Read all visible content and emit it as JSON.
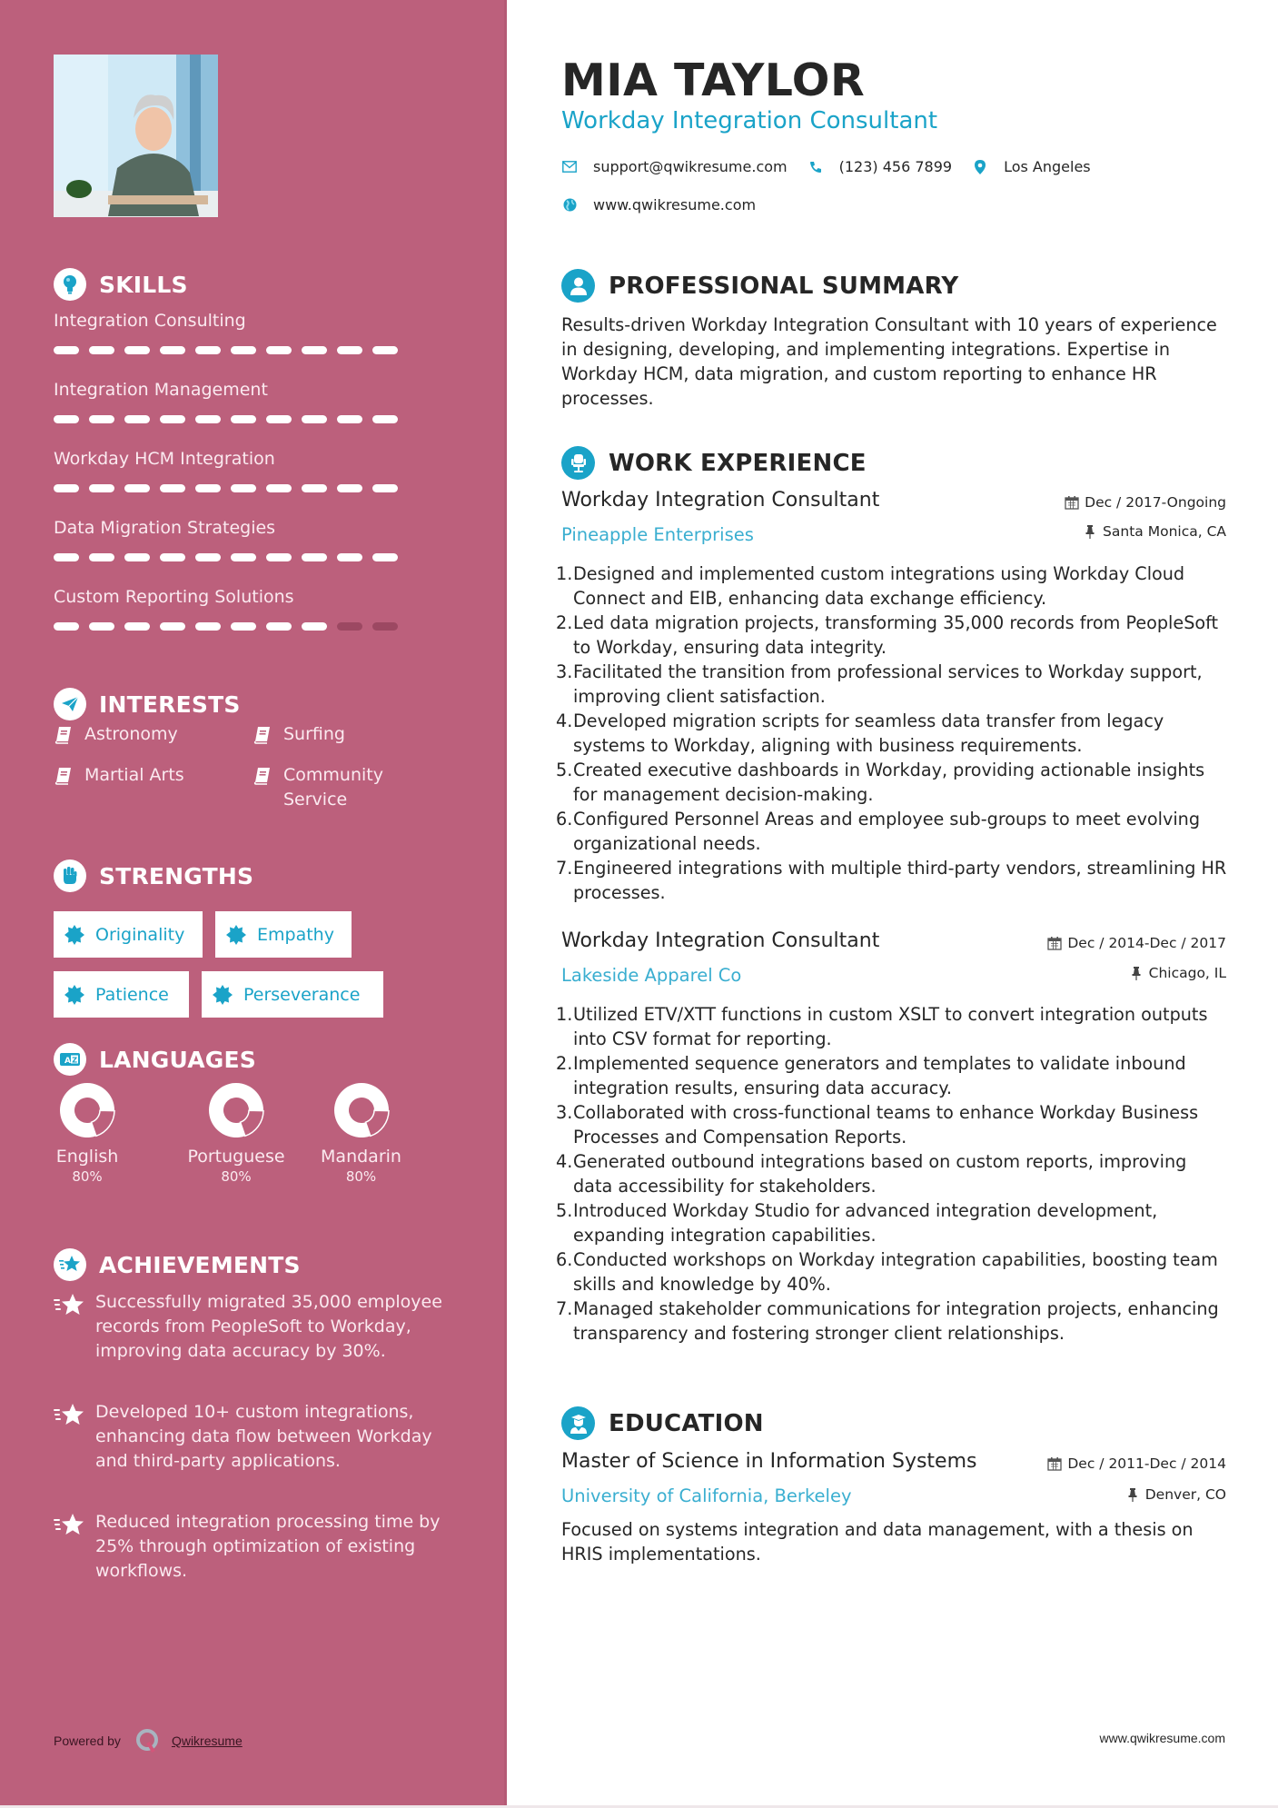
{
  "colors": {
    "sidebar_bg": "#bc607c",
    "accent": "#1aa3c8",
    "text_dark": "#262626",
    "sidebar_text": "#fbeaf0",
    "skill_off": "#9c4862"
  },
  "profile": {
    "photo_alt": "Profile photo",
    "name": "MIA TAYLOR",
    "title": "Workday Integration Consultant"
  },
  "contact": {
    "email": "support@qwikresume.com",
    "phone": "(123) 456 7899",
    "location": "Los Angeles",
    "website": "www.qwikresume.com",
    "icons": [
      "envelope-icon",
      "phone-icon",
      "map-pin-icon",
      "globe-icon"
    ]
  },
  "sidebar": {
    "skills": {
      "title": "SKILLS",
      "icon": "lightbulb-icon",
      "scale_max": 10,
      "items": [
        {
          "name": "Integration Consulting",
          "level": 10
        },
        {
          "name": "Integration Management",
          "level": 10
        },
        {
          "name": "Workday HCM Integration",
          "level": 10
        },
        {
          "name": "Data Migration Strategies",
          "level": 10
        },
        {
          "name": "Custom Reporting Solutions",
          "level": 8
        }
      ]
    },
    "interests": {
      "title": "INTERESTS",
      "icon": "paper-plane-icon",
      "items": [
        "Astronomy",
        "Surfing",
        "Martial Arts",
        "Community Service"
      ]
    },
    "strengths": {
      "title": "STRENGTHS",
      "icon": "fist-icon",
      "items": [
        "Originality",
        "Empathy",
        "Patience",
        "Perseverance"
      ]
    },
    "languages": {
      "title": "LANGUAGES",
      "icon": "translate-icon",
      "items": [
        {
          "name": "English",
          "percent": 80,
          "label": "80%"
        },
        {
          "name": "Portuguese",
          "percent": 80,
          "label": "80%"
        },
        {
          "name": "Mandarin",
          "percent": 80,
          "label": "80%"
        }
      ]
    },
    "achievements": {
      "title": "ACHIEVEMENTS",
      "icon": "star-badge-icon",
      "items": [
        "Successfully migrated 35,000 employee records from PeopleSoft to Workday, improving data accuracy by 30%.",
        "Developed 10+ custom integrations, enhancing data flow between Workday and third-party applications.",
        "Reduced integration processing time by 25% through optimization of existing workflows."
      ]
    },
    "footer": {
      "powered_by": "Powered by",
      "brand": "Qwikresume"
    }
  },
  "summary": {
    "title": "PROFESSIONAL SUMMARY",
    "text": "Results-driven Workday Integration Consultant with 10 years of experience in designing, developing, and implementing integrations. Expertise in Workday HCM, data migration, and custom reporting to enhance HR processes."
  },
  "experience": {
    "title": "WORK EXPERIENCE",
    "jobs": [
      {
        "role": "Workday Integration Consultant",
        "company": "Pineapple Enterprises",
        "dates": "Dec / 2017-Ongoing",
        "location": "Santa Monica, CA",
        "bullets": [
          "Designed and implemented custom integrations using Workday Cloud Connect and EIB, enhancing data exchange efficiency.",
          "Led data migration projects, transforming 35,000 records from PeopleSoft to Workday, ensuring data integrity.",
          "Facilitated the transition from professional services to Workday support, improving client satisfaction.",
          "Developed migration scripts for seamless data transfer from legacy systems to Workday, aligning with business requirements.",
          "Created executive dashboards in Workday, providing actionable insights for management decision-making.",
          "Configured Personnel Areas and employee sub-groups to meet evolving organizational needs.",
          "Engineered integrations with multiple third-party vendors, streamlining HR processes."
        ]
      },
      {
        "role": "Workday Integration Consultant",
        "company": "Lakeside Apparel Co",
        "dates": "Dec / 2014-Dec / 2017",
        "location": "Chicago, IL",
        "bullets": [
          "Utilized ETV/XTT functions in custom XSLT to convert integration outputs into CSV format for reporting.",
          "Implemented sequence generators and templates to validate inbound integration results, ensuring data accuracy.",
          "Collaborated with cross-functional teams to enhance Workday Business Processes and Compensation Reports.",
          "Generated outbound integrations based on custom reports, improving data accessibility for stakeholders.",
          "Introduced Workday Studio for advanced integration development, expanding integration capabilities.",
          "Conducted workshops on Workday integration capabilities, boosting team skills and knowledge by 40%.",
          "Managed stakeholder communications for integration projects, enhancing transparency and fostering stronger client relationships."
        ]
      }
    ]
  },
  "education": {
    "title": "EDUCATION",
    "degree": "Master of Science in Information Systems",
    "school": "University of California, Berkeley",
    "dates": "Dec / 2011-Dec / 2014",
    "location": "Denver, CO",
    "description": "Focused on systems integration and data management, with a thesis on HRIS implementations."
  },
  "footer": {
    "url": "www.qwikresume.com"
  }
}
